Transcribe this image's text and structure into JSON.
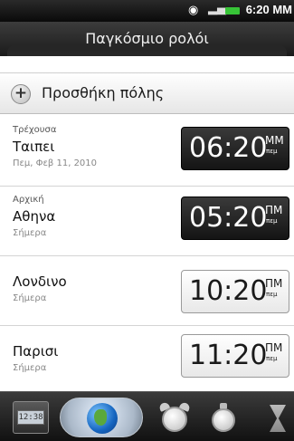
{
  "status_bar": {
    "wifi_icon": "wifi-icon",
    "signal_icon": "signal-icon",
    "battery_icon": "battery-icon",
    "time": "6:20 MM"
  },
  "header": {
    "title": "Παγκόσμιο ρολόι"
  },
  "add_city": {
    "icon": "plus-icon",
    "label": "Προσθήκη πόλης"
  },
  "cities": [
    {
      "sublabel": "Τρέχουσα",
      "name": "Ταιπει",
      "date": "Πεμ, Φεβ 11, 2010",
      "time": "06:20",
      "ampm": "MM",
      "ampm_sub": "πεμ",
      "style": "dark"
    },
    {
      "sublabel": "Αρχική",
      "name": "Αθηνα",
      "date": "Σήμερα",
      "time": "05:20",
      "ampm": "ΠΜ",
      "ampm_sub": "πεμ",
      "style": "dark"
    },
    {
      "sublabel": "",
      "name": "Λονδινο",
      "date": "Σήμερα",
      "time": "10:20",
      "ampm": "ΠΜ",
      "ampm_sub": "πεμ",
      "style": "light"
    },
    {
      "sublabel": "",
      "name": "Παρισι",
      "date": "Σήμερα",
      "time": "11:20",
      "ampm": "ΠΜ",
      "ampm_sub": "πεμ",
      "style": "light"
    }
  ],
  "tabs": [
    {
      "icon": "desk-clock-icon",
      "label": "12:38"
    },
    {
      "icon": "globe-icon",
      "selected": true
    },
    {
      "icon": "alarm-clock-icon"
    },
    {
      "icon": "stopwatch-icon"
    },
    {
      "icon": "hourglass-timer-icon"
    }
  ],
  "colors": {
    "battery": "#37c437",
    "header_bg": "#2a2a2a",
    "content_bg": "#ffffff"
  }
}
